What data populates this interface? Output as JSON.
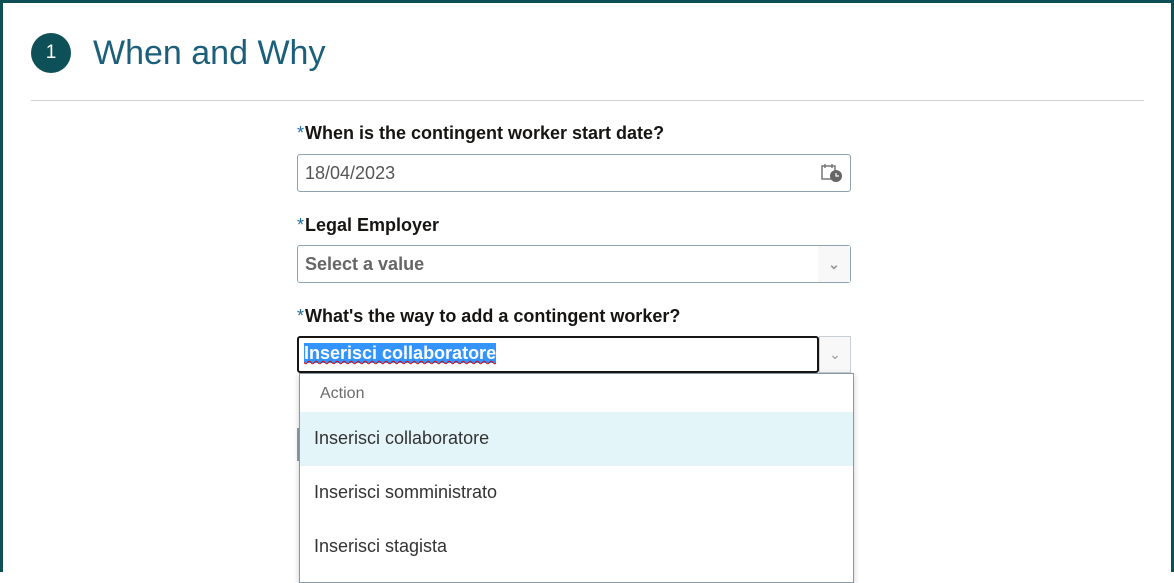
{
  "section": {
    "number": "1",
    "title": "When and Why"
  },
  "start_date": {
    "required": "*",
    "label": "When is the contingent worker start date?",
    "value": "18/04/2023"
  },
  "legal_employer": {
    "required": "*",
    "label": "Legal Employer",
    "placeholder": "Select a value"
  },
  "add_way": {
    "required": "*",
    "label": "What's the way to add a contingent worker?",
    "value": "Inserisci collaboratore"
  },
  "dropdown": {
    "header": "Action",
    "options": [
      "Inserisci collaboratore",
      "Inserisci somministrato",
      "Inserisci stagista"
    ]
  }
}
